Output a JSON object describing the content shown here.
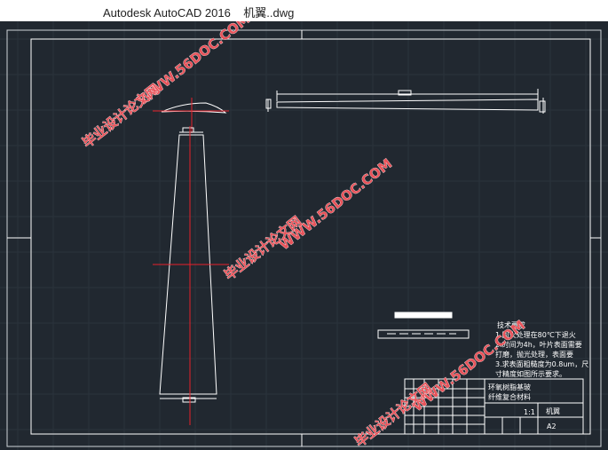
{
  "window": {
    "app_title": "Autodesk AutoCAD 2016",
    "file_name": "机翼..dwg"
  },
  "drawing": {
    "tech_req_title": "技术要求",
    "tech_req_lines": [
      "1.回火处理在80℃下退火",
      "2.时间为4h，叶片表面需要",
      "打磨，抛光处理，表面要",
      "3.求表面粗糙度为0.8um，尺",
      "寸精度如图所示要求。"
    ],
    "material_lines": [
      "环氧树脂基玻",
      "纤维复合材料"
    ],
    "part_name": "机翼",
    "sheet_size": "A2",
    "scale": "1:1"
  },
  "watermarks": {
    "site": "WWW.56DOC.COM",
    "label": "毕业设计论文网"
  },
  "colors": {
    "canvas_bg": "#212830",
    "line": "#ffffff",
    "centerline": "#e8202a",
    "watermark": "#e8535a"
  }
}
